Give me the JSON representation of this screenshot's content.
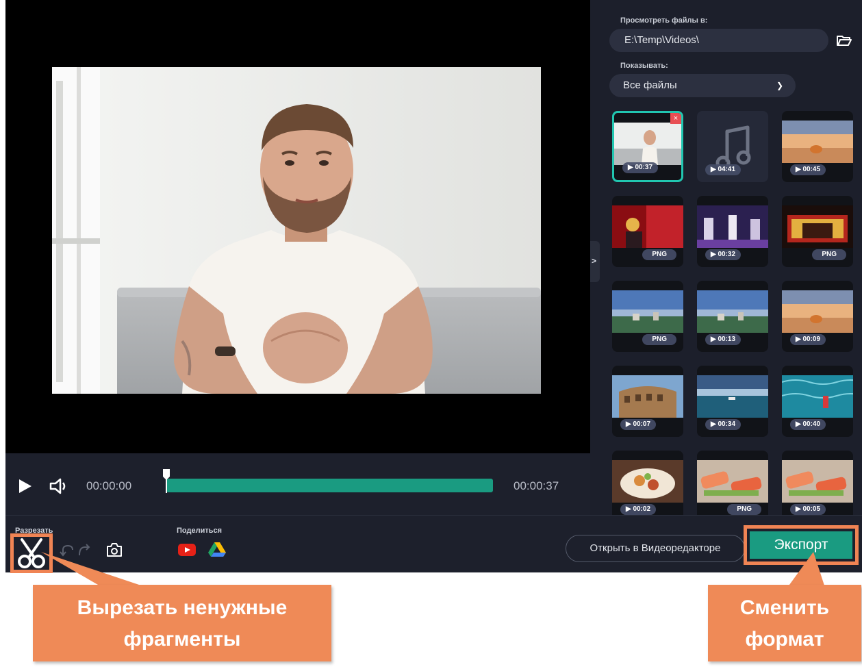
{
  "player": {
    "current_time": "00:00:00",
    "total_time": "00:00:37",
    "progress": 0.0
  },
  "toolbar": {
    "cut_label": "Разрезать",
    "share_label": "Поделиться",
    "open_editor_label": "Открыть в Видеоредакторе",
    "export_label": "Экспорт"
  },
  "side": {
    "browse_label": "Просмотреть файлы в:",
    "path_value": "E:\\Temp\\Videos\\",
    "show_label": "Показывать:",
    "show_value": "Все файлы",
    "files": [
      {
        "badge": "▶ 00:37",
        "kind": "video",
        "selected": true,
        "thumb": "man"
      },
      {
        "badge": "▶ 04:41",
        "kind": "audio",
        "thumb": "note"
      },
      {
        "badge": "▶ 00:45",
        "kind": "video",
        "thumb": "sunset-cat"
      },
      {
        "badge": "PNG",
        "kind": "image",
        "thumb": "stage-red"
      },
      {
        "badge": "▶ 00:32",
        "kind": "video",
        "thumb": "concert"
      },
      {
        "badge": "PNG",
        "kind": "image",
        "thumb": "stage-gold"
      },
      {
        "badge": "PNG",
        "kind": "image",
        "thumb": "sky-city"
      },
      {
        "badge": "▶ 00:13",
        "kind": "video",
        "thumb": "sky-city"
      },
      {
        "badge": "▶ 00:09",
        "kind": "video",
        "thumb": "sunset-cat"
      },
      {
        "badge": "▶ 00:07",
        "kind": "video",
        "thumb": "colosseum"
      },
      {
        "badge": "▶ 00:34",
        "kind": "video",
        "thumb": "lake"
      },
      {
        "badge": "▶ 00:40",
        "kind": "video",
        "thumb": "pool"
      },
      {
        "badge": "▶ 00:02",
        "kind": "video",
        "thumb": "food"
      },
      {
        "badge": "PNG",
        "kind": "image",
        "thumb": "sushi"
      },
      {
        "badge": "▶ 00:05",
        "kind": "video",
        "thumb": "sushi"
      }
    ]
  },
  "callouts": {
    "cut_line1": "Вырезать ненужные",
    "cut_line2": "фрагменты",
    "export_line1": "Сменить",
    "export_line2": "формат"
  },
  "colors": {
    "accent": "#1a9b81",
    "callout": "#ef8a57",
    "selection": "#21c6b0",
    "panel": "#1c1f2b"
  },
  "icons": [
    "play-icon",
    "volume-icon",
    "scissors-icon",
    "undo-icon",
    "redo-icon",
    "camera-icon",
    "youtube-icon",
    "google-drive-icon",
    "folder-icon",
    "chevron-down-icon",
    "chevron-right-icon",
    "close-icon",
    "music-note-icon"
  ]
}
